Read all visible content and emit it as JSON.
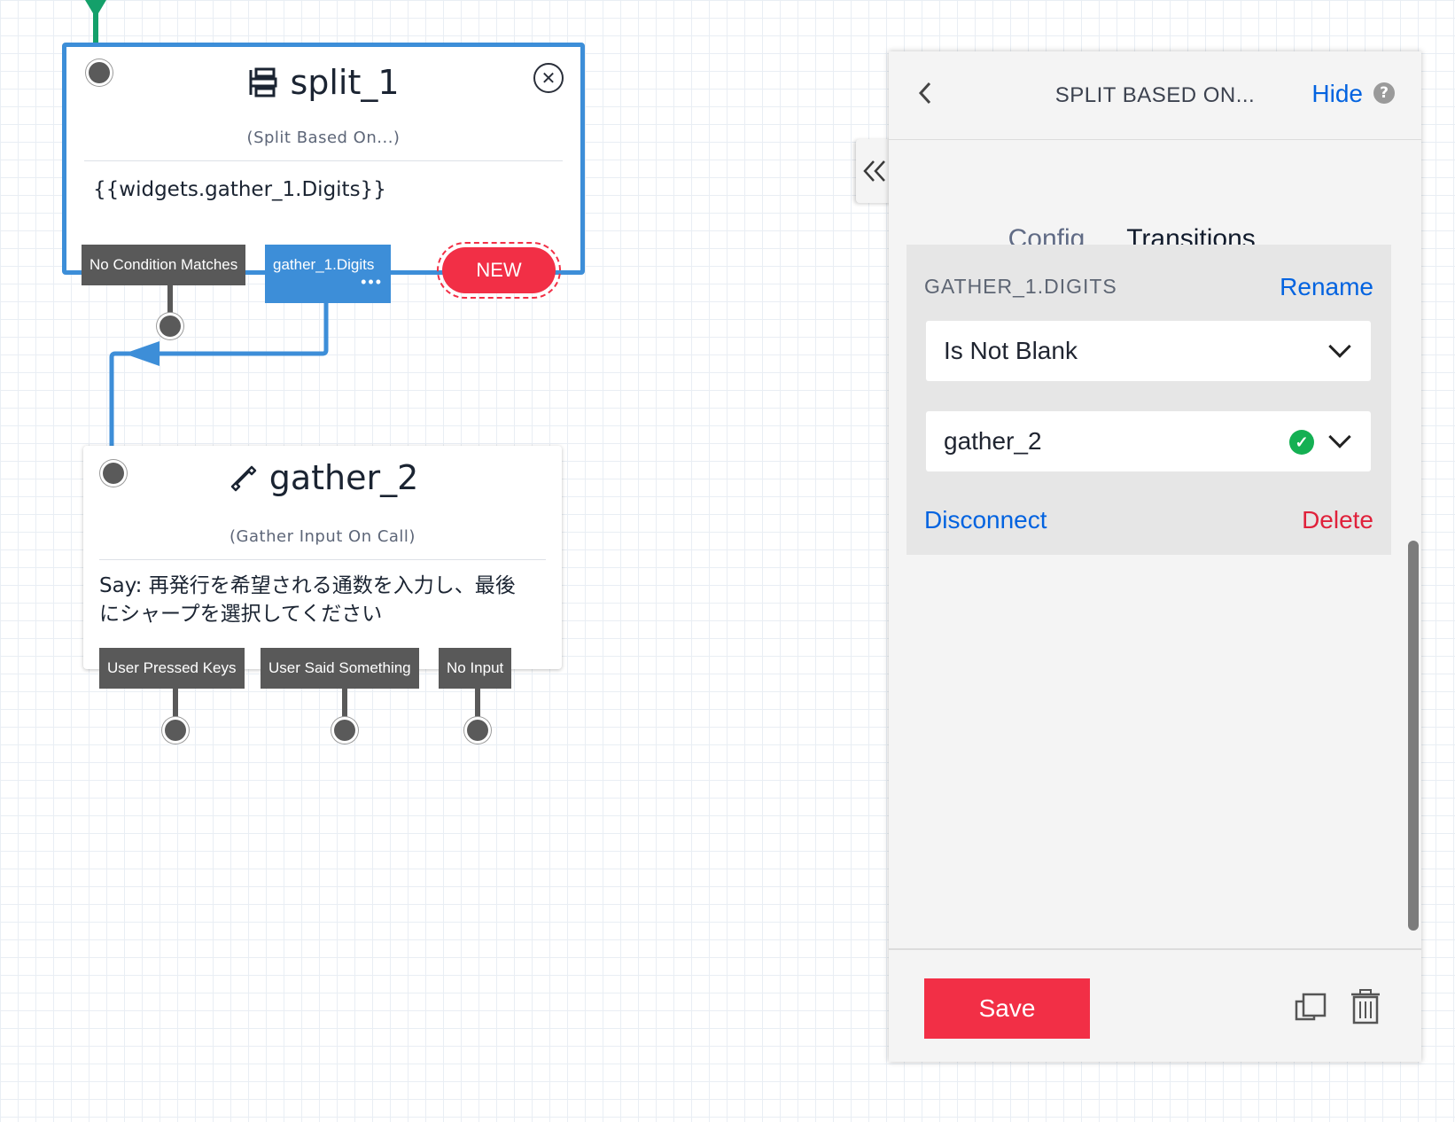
{
  "split_widget": {
    "title": "split_1",
    "subtitle": "(Split Based On...)",
    "body": "{{widgets.gather_1.Digits}}",
    "icon": "split-icon",
    "transitions": [
      "No Condition Matches",
      "gather_1.Digits"
    ],
    "more": "•••",
    "new_label": "NEW"
  },
  "gather_widget": {
    "title": "gather_2",
    "subtitle": "(Gather Input On Call)",
    "body": "Say: 再発行を希望される通数を入力し、最後にシャープを選択してください",
    "icon": "phone-icon",
    "transitions": [
      "User Pressed Keys",
      "User Said Something",
      "No Input"
    ]
  },
  "panel": {
    "title": "SPLIT BASED ON...",
    "hide_label": "Hide",
    "help": "?",
    "back_icon": "chevron-left-icon",
    "collapse_icon": "double-chevron-left-icon",
    "tabs": [
      {
        "label": "Config",
        "active": false
      },
      {
        "label": "Transitions",
        "active": true
      }
    ],
    "transition": {
      "label": "GATHER_1.DIGITS",
      "rename_label": "Rename",
      "condition": "Is Not Blank",
      "target": "gather_2",
      "disconnect_label": "Disconnect",
      "delete_label": "Delete"
    },
    "save_label": "Save",
    "duplicate_icon": "duplicate-icon",
    "trash_icon": "trash-icon"
  },
  "colors": {
    "accent_red": "#f22f46",
    "link_blue": "#0263e0",
    "connector_blue": "#3d8ed8",
    "tag_gray": "#595959",
    "success_green": "#14b053",
    "incoming_green": "#14a06a"
  }
}
